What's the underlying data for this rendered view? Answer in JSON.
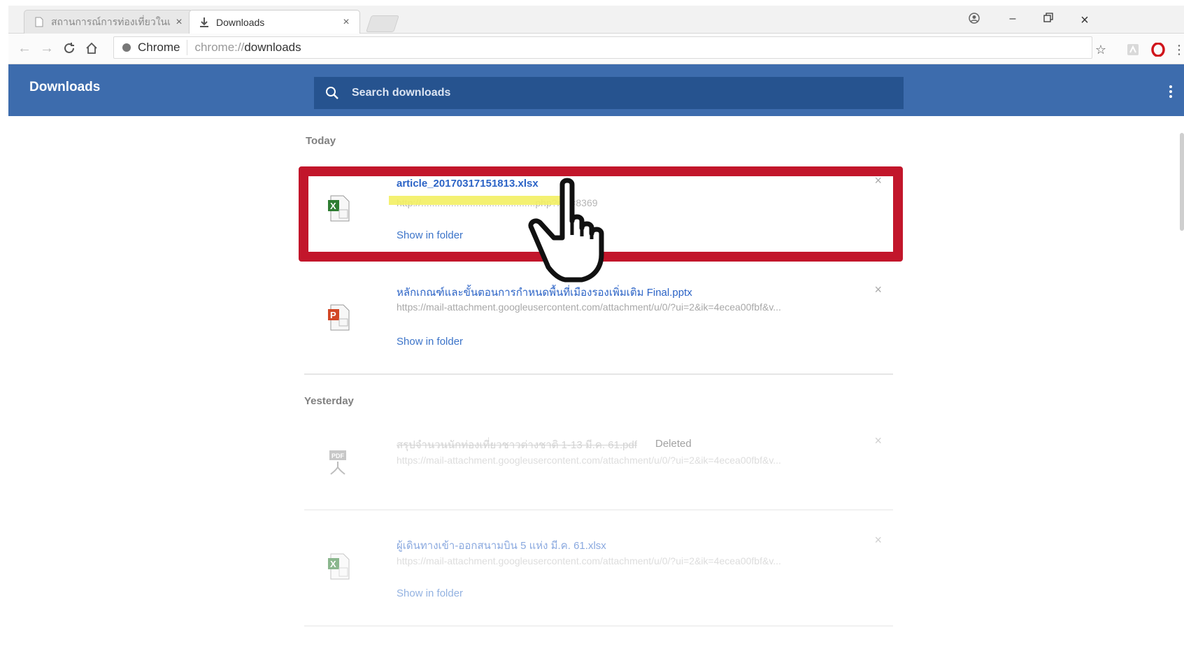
{
  "tabs": [
    {
      "title": "สถานการณ์การท่องเที่ยวในเ...",
      "close": "×",
      "icon": "page-icon"
    },
    {
      "title": "Downloads",
      "close": "×",
      "icon": "download-icon"
    }
  ],
  "window_controls": {
    "profile": "account-icon",
    "minimize": "–",
    "restore": "restore-icon",
    "close": "×"
  },
  "toolbar": {
    "secure_label": "Chrome",
    "url_scheme": "chrome://",
    "url_path": "downloads"
  },
  "header": {
    "title": "Downloads",
    "search_placeholder": "Search downloads"
  },
  "sections": {
    "today": "Today",
    "yesterday": "Yesterday"
  },
  "downloads": [
    {
      "filename": "article_20170317151813.xlsx",
      "url": "http://..........................................php?nid=8369",
      "action": "Show in folder",
      "type": "xlsx",
      "highlighted": true
    },
    {
      "filename": "หลักเกณฑ์และขั้นตอนการกำหนดพื้นที่เมืองรองเพิ่มเติม Final.pptx",
      "url": "https://mail-attachment.googleusercontent.com/attachment/u/0/?ui=2&ik=4ecea00fbf&v...",
      "action": "Show in folder",
      "type": "pptx"
    },
    {
      "filename": "สรุปจำนวนนักท่องเที่ยวชาวต่างชาติ 1-13 มี.ค. 61.pdf",
      "url": "https://mail-attachment.googleusercontent.com/attachment/u/0/?ui=2&ik=4ecea00fbf&v...",
      "status": "Deleted",
      "type": "pdf"
    },
    {
      "filename": "ผู้เดินทางเข้า-ออกสนามบิน 5 แห่ง มี.ค. 61.xlsx",
      "url": "https://mail-attachment.googleusercontent.com/attachment/u/0/?ui=2&ik=4ecea00fbf&v...",
      "action": "Show in folder",
      "type": "xlsx"
    }
  ],
  "colors": {
    "header": "#3d6cad",
    "search": "#26538f",
    "highlight": "#c2162b",
    "link": "#3c74c9"
  }
}
